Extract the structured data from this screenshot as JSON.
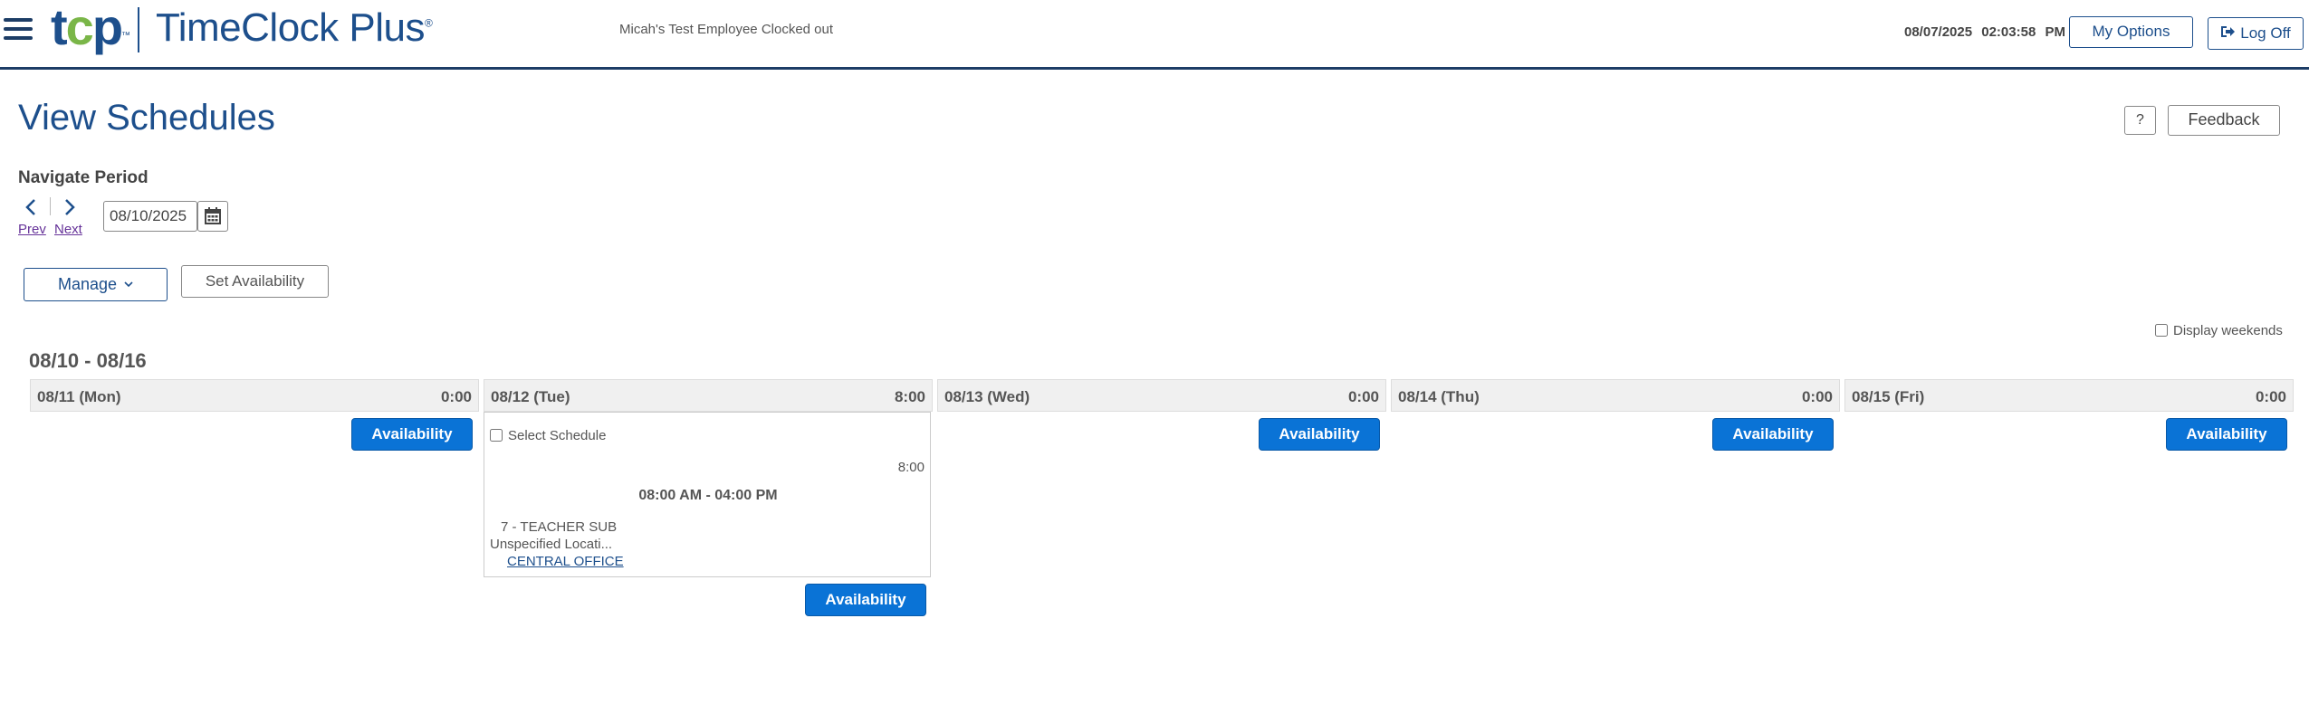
{
  "header": {
    "logo_tcp": "tcp",
    "logo_text": "TimeClock Plus",
    "status": "Micah's Test Employee Clocked out",
    "date": "08/07/2025",
    "time": "02:03:58 PM",
    "my_options_label": "My Options",
    "log_off_label": "Log Off"
  },
  "page": {
    "title": "View Schedules",
    "help_label": "?",
    "feedback_label": "Feedback"
  },
  "navigate": {
    "label": "Navigate Period",
    "prev_label": "Prev",
    "next_label": "Next",
    "date_value": "08/10/2025"
  },
  "toolbar": {
    "manage_label": "Manage",
    "set_availability_label": "Set Availability"
  },
  "display_weekends": {
    "label": "Display weekends",
    "checked": false
  },
  "week": {
    "range": "08/10 - 08/16",
    "days": [
      {
        "date": "08/11 (Mon)",
        "hours": "0:00",
        "availability_label": "Availability"
      },
      {
        "date": "08/12 (Tue)",
        "hours": "8:00",
        "availability_label": "Availability",
        "schedule": {
          "select_label": "Select Schedule",
          "hours": "8:00",
          "time_range": "08:00 AM - 04:00 PM",
          "job": "7 - TEACHER SUB",
          "location": "Unspecified Locati...",
          "office": "CENTRAL OFFICE"
        }
      },
      {
        "date": "08/13 (Wed)",
        "hours": "0:00",
        "availability_label": "Availability"
      },
      {
        "date": "08/14 (Thu)",
        "hours": "0:00",
        "availability_label": "Availability"
      },
      {
        "date": "08/15 (Fri)",
        "hours": "0:00",
        "availability_label": "Availability"
      }
    ]
  },
  "colors": {
    "brand_navy": "#1d4f8c",
    "brand_green": "#7ab648",
    "primary_button": "#0a73d6",
    "visited_link": "#663399"
  }
}
